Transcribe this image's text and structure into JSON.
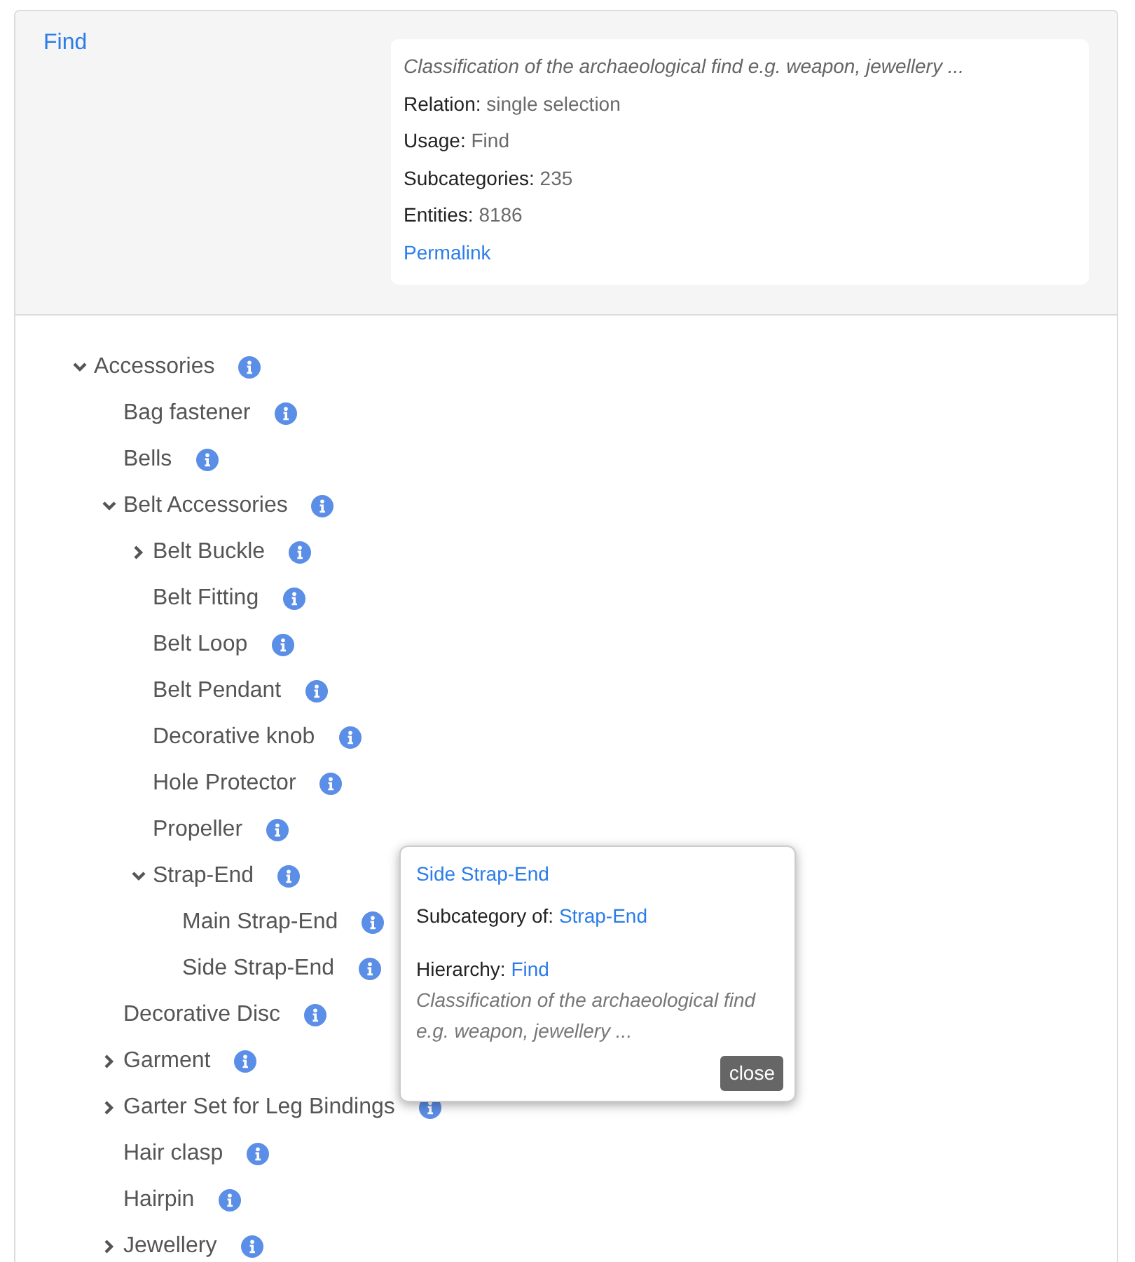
{
  "header": {
    "title": "Find",
    "description": "Classification of the archaeological find e.g. weapon, jewellery ...",
    "fields": [
      {
        "label": "Relation:",
        "value": "single selection"
      },
      {
        "label": "Usage:",
        "value": "Find"
      },
      {
        "label": "Subcategories:",
        "value": "235"
      },
      {
        "label": "Entities:",
        "value": "8186"
      }
    ],
    "permalink": "Permalink"
  },
  "tree": [
    {
      "label": "Accessories",
      "expanded": true,
      "children": [
        {
          "label": "Bag fastener"
        },
        {
          "label": "Bells"
        },
        {
          "label": "Belt Accessories",
          "expanded": true,
          "children": [
            {
              "label": "Belt Buckle",
              "expanded": false
            },
            {
              "label": "Belt Fitting"
            },
            {
              "label": "Belt Loop"
            },
            {
              "label": "Belt Pendant"
            },
            {
              "label": "Decorative knob"
            },
            {
              "label": "Hole Protector"
            },
            {
              "label": "Propeller"
            },
            {
              "label": "Strap-End",
              "expanded": true,
              "children": [
                {
                  "label": "Main Strap-End"
                },
                {
                  "label": "Side Strap-End"
                }
              ]
            }
          ]
        },
        {
          "label": "Decorative Disc"
        },
        {
          "label": "Garment",
          "expanded": false
        },
        {
          "label": "Garter Set for Leg Bindings",
          "expanded": false
        },
        {
          "label": "Hair clasp"
        },
        {
          "label": "Hairpin"
        },
        {
          "label": "Jewellery",
          "expanded": false
        }
      ]
    }
  ],
  "popover": {
    "title": "Side Strap-End",
    "subcategory_label": "Subcategory of:",
    "subcategory_link": "Strap-End",
    "hierarchy_label": "Hierarchy:",
    "hierarchy_link": "Find",
    "description": "Classification of the archaeological find e.g. weapon, jewellery ...",
    "close": "close"
  }
}
